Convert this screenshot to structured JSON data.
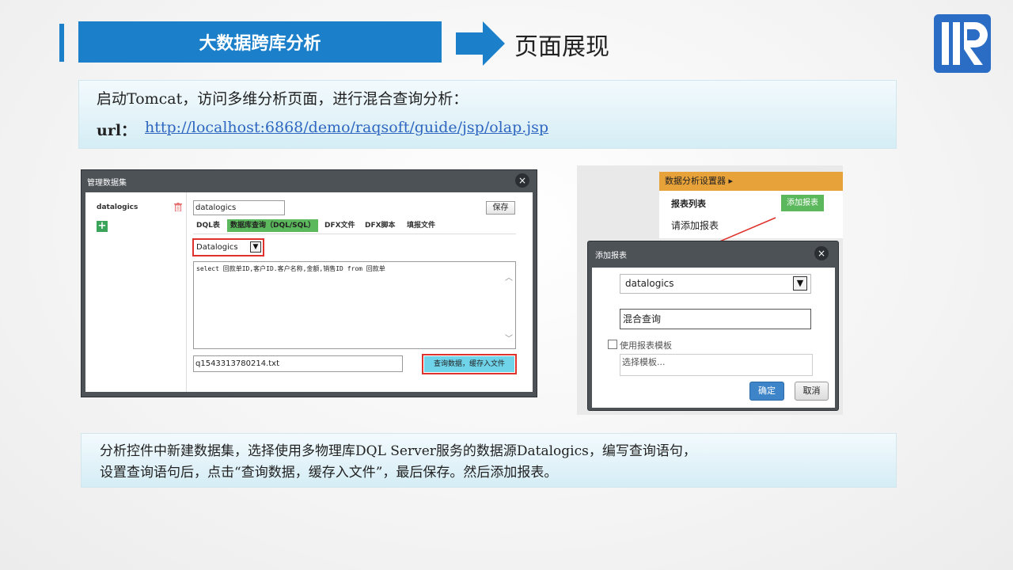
{
  "header": {
    "banner_title": "大数据跨库分析",
    "section_title": "页面展现"
  },
  "intro": {
    "text": "启动Tomcat，访问多维分析页面，进行混合查询分析：",
    "url_label": "url：",
    "url": "http://localhost:6868/demo/raqsoft/guide/jsp/olap.jsp"
  },
  "left_dialog": {
    "title": "管理数据集",
    "close": "×",
    "datasource_list": [
      "datalogics"
    ],
    "add": "+",
    "name_value": "datalogics",
    "save_label": "保存",
    "tabs": [
      "DQL表",
      "数据库查询（DQL/SQL）",
      "DFX文件",
      "DFX脚本",
      "填报文件"
    ],
    "db_selected": "Datalogics",
    "sql": "select 回款单ID,客户ID.客户名称,金额,销售ID from 回款单",
    "file_name": "q1543313780214.txt",
    "query_button": "查询数据，缓存入文件"
  },
  "right_panel": {
    "menu_title": "数据分析设置器",
    "menu_items": [
      "报表列表",
      "请添加报表"
    ],
    "add_report_button": "添加报表",
    "dialog_title": "添加报表",
    "close": "×",
    "ds_selected": "datalogics",
    "report_name": "混合查询",
    "use_template_label": "使用报表模板",
    "template_placeholder": "选择模板...",
    "ok_label": "确定",
    "cancel_label": "取消"
  },
  "description": {
    "line1": "分析控件中新建数据集，选择使用多物理库DQL Server服务的数据源Datalogics，编写查询语句，",
    "line2": "设置查询语句后，点击“查询数据，缓存入文件”，最后保存。然后添加报表。"
  },
  "colors": {
    "accent_blue": "#1b7fc9",
    "tab_green": "#5cb85c",
    "highlight_red": "#e0322c",
    "menu_orange": "#e8a23a",
    "query_cyan": "#6fd3ea"
  }
}
